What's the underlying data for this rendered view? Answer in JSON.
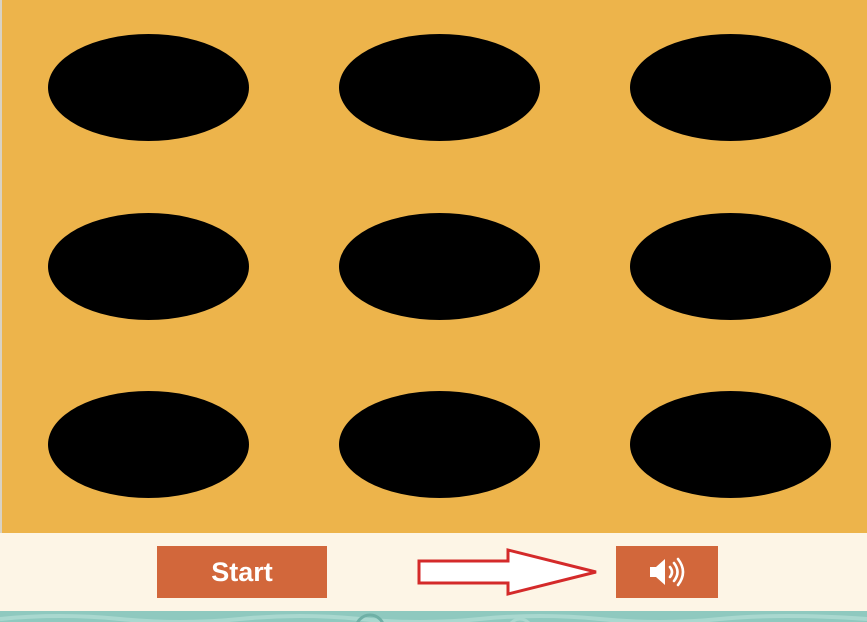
{
  "game": {
    "board_color": "#edb44b",
    "hole_color": "#000000",
    "holes": [
      {
        "row": 1,
        "col": 1
      },
      {
        "row": 1,
        "col": 2
      },
      {
        "row": 1,
        "col": 3
      },
      {
        "row": 2,
        "col": 1
      },
      {
        "row": 2,
        "col": 2
      },
      {
        "row": 2,
        "col": 3
      },
      {
        "row": 3,
        "col": 1
      },
      {
        "row": 3,
        "col": 2
      },
      {
        "row": 3,
        "col": 3
      }
    ]
  },
  "controls": {
    "start_label": "Start",
    "sound_icon": "speaker-volume-icon",
    "button_color": "#d2673b",
    "annotation_arrow": "red-outline-arrow-pointing-right"
  }
}
